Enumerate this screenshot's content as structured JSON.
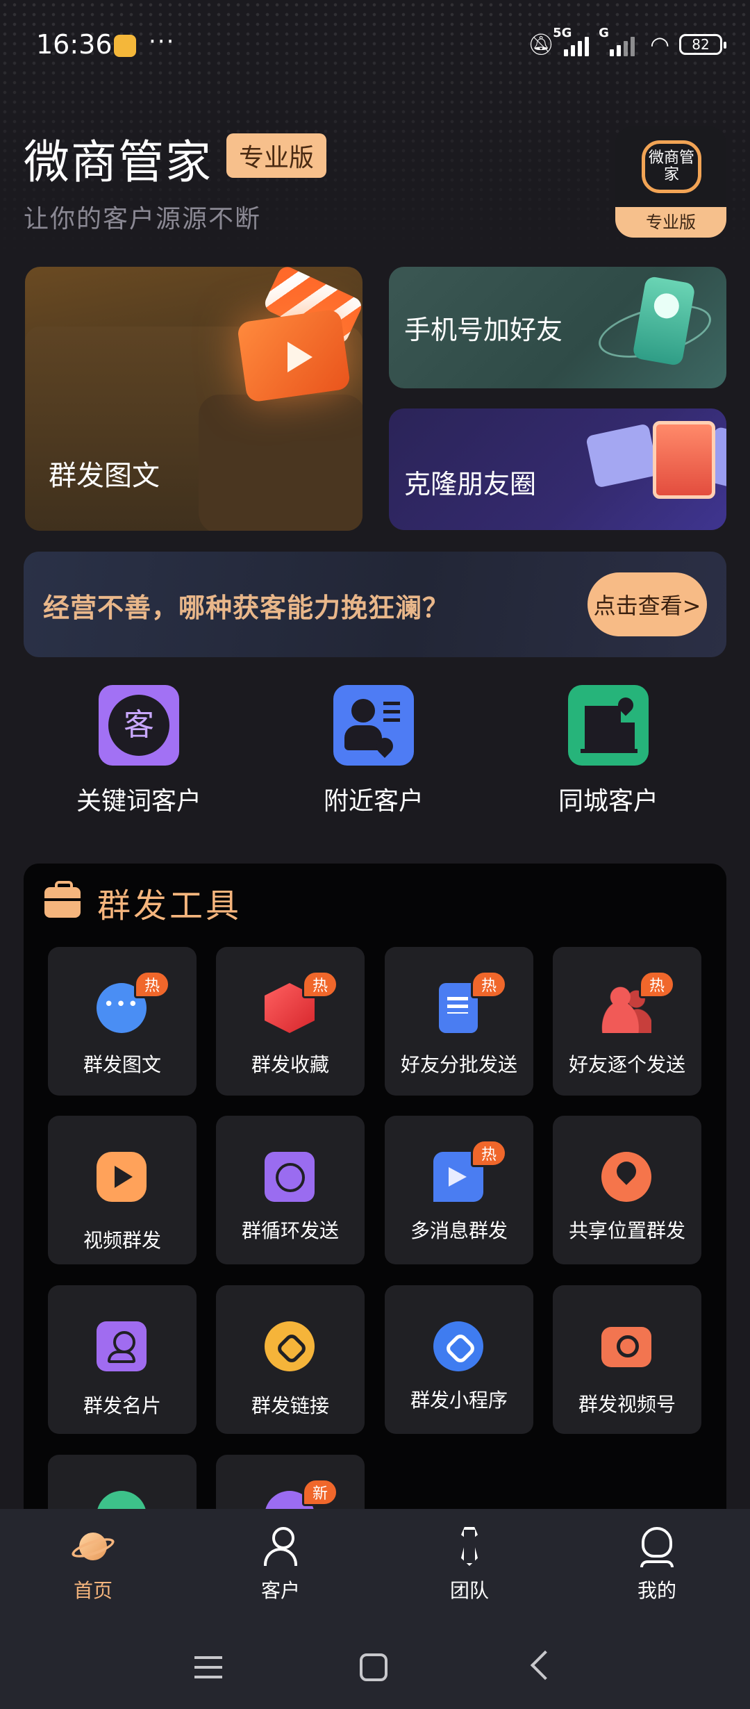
{
  "status_bar": {
    "time": "16:36",
    "more": "···",
    "net1": "5G",
    "net2": "G",
    "battery": "82"
  },
  "header": {
    "app_title": "微商管家",
    "edition_badge": "专业版",
    "subtitle": "让你的客户源源不断",
    "logo_text": "微商管家",
    "logo_strip": "专业版"
  },
  "features": {
    "group_send": "群发图文",
    "phone_add": "手机号加好友",
    "clone_moments": "克隆朋友圈"
  },
  "banner": {
    "text": "经营不善，哪种获客能力挽狂澜？",
    "button": "点击查看>"
  },
  "quick_nav": [
    {
      "label": "关键词客户",
      "icon_char": "客",
      "icon": "keyword-customer-icon"
    },
    {
      "label": "附近客户",
      "icon": "nearby-customer-icon"
    },
    {
      "label": "同城客户",
      "icon": "same-city-customer-icon"
    }
  ],
  "tools": {
    "title": "群发工具",
    "hot_badge": "热",
    "new_badge": "新",
    "items": [
      {
        "label": "群发图文",
        "icon": "chat-bubble-icon",
        "badge": "热"
      },
      {
        "label": "群发收藏",
        "icon": "cube-icon",
        "badge": "热"
      },
      {
        "label": "好友分批发送",
        "icon": "documents-icon",
        "badge": "热"
      },
      {
        "label": "好友逐个发送",
        "icon": "people-icon",
        "badge": "热"
      },
      {
        "label": "视频群发",
        "icon": "play-icon"
      },
      {
        "label": "群循环发送",
        "icon": "loop-send-icon"
      },
      {
        "label": "多消息群发",
        "icon": "multi-message-icon",
        "badge": "热"
      },
      {
        "label": "共享位置群发",
        "icon": "location-icon"
      },
      {
        "label": "群发名片",
        "icon": "contact-card-icon"
      },
      {
        "label": "群发链接",
        "icon": "link-icon"
      },
      {
        "label": "群发小程序",
        "icon": "mini-program-icon"
      },
      {
        "label": "群发视频号",
        "icon": "camera-icon"
      },
      {
        "label": "",
        "icon": "green-tool-icon"
      },
      {
        "label": "",
        "icon": "purple-tool-icon",
        "badge": "新"
      }
    ]
  },
  "bottom_nav": [
    {
      "label": "首页",
      "active": true
    },
    {
      "label": "客户"
    },
    {
      "label": "团队"
    },
    {
      "label": "我的"
    }
  ],
  "colors": {
    "accent": "#f5b57d",
    "background": "#1b1a1f",
    "panel": "#050506",
    "tile": "#202024",
    "hot_badge": "#f0672b"
  }
}
